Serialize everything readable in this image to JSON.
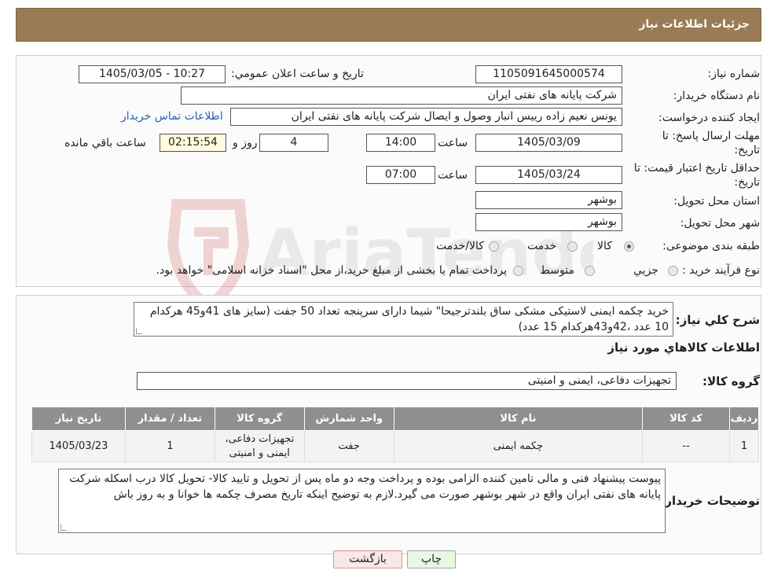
{
  "header": {
    "title": "جزئیات اطلاعات نیاز"
  },
  "labels": {
    "need_number": "شماره نیاز:",
    "announce_datetime": "تاریخ و ساعت اعلان عمومي:",
    "buyer_org": "نام دستگاه خریدار:",
    "requester": "ایجاد کننده درخواست:",
    "reply_deadline_line1": "مهلت ارسال پاسخ: تا",
    "reply_deadline_line2": "تاریخ:",
    "time": "ساعت",
    "days_and": "روز و",
    "remaining": "ساعت باقي مانده",
    "price_validity_line1": "حداقل تاریخ اعتبار قیمت: تا",
    "price_validity_line2": "تاریخ:",
    "province": "استان محل تحویل:",
    "city": "شهر محل تحویل:",
    "category": "طبقه بندی موضوعی:",
    "process_type": "نوع فرآیند خرید :",
    "description": "شرح کلي نیاز:",
    "goods_info": "اطلاعات کالاهاي مورد نیاز",
    "goods_group": "گروه کالا:",
    "buyer_notes": "توضیحات خریدار:"
  },
  "values": {
    "need_number": "1105091645000574",
    "announce_datetime": "1405/03/05 - 10:27",
    "buyer_org": "شرکت پایانه های نفتی ایران",
    "requester": "یونس نعیم زاده رییس انبار وصول و ایصال شرکت پایانه های نفتی ایران",
    "contact_link": "اطلاعات تماس خریدار",
    "reply_date": "1405/03/09",
    "reply_time": "14:00",
    "days_left": "4",
    "time_left": "02:15:54",
    "price_date": "1405/03/24",
    "price_time": "07:00",
    "province": "بوشهر",
    "city": "بوشهر",
    "description": "خرید چکمه ایمنی لاستیکی مشکی ساق بلندترجیحا\" شیما دارای سرپنجه تعداد 50 جفت (سایز های 41و45 هرکدام 10 عدد ،42و43هرکدام 15 عدد)",
    "goods_group": "تجهیزات دفاعی، ایمنی و امنیتی",
    "buyer_notes": "پیوست پیشنهاد فنی و مالی تامین کننده الزامی بوده و پرداخت وجه دو ماه پس از تحویل و تایید کالا- تحویل کالا درب اسکله شرکت پایانه های نفتی ایران واقع در شهر بوشهر صورت می گیرد.لازم به توضیح اینکه تاریخ مصرف چکمه ها خوانا و به روز باش"
  },
  "category_options": [
    {
      "label": "کالا",
      "selected": true
    },
    {
      "label": "خدمت",
      "selected": false
    },
    {
      "label": "کالا/خدمت",
      "selected": false
    }
  ],
  "process_options": [
    {
      "label": "جزیي",
      "selected": false
    },
    {
      "label": "متوسط",
      "selected": false
    },
    {
      "label": "پرداخت تمام یا بخشی از مبلغ خرید،از محل \"اسناد خزانه اسلامی\" خواهد بود.",
      "selected": false
    }
  ],
  "table": {
    "headers": [
      "ردیف",
      "کد کالا",
      "نام کالا",
      "واحد شمارش",
      "گروه کالا",
      "تعداد / مقدار",
      "تاریخ نیاز"
    ],
    "rows": [
      [
        "1",
        "--",
        "چکمه ایمنی",
        "جفت",
        "تجهیزات دفاعی، ایمنی و امنیتی",
        "1",
        "1405/03/23"
      ]
    ]
  },
  "buttons": {
    "print": "چاپ",
    "back": "بازگشت"
  },
  "watermark": {
    "text": "AriaTender.neT"
  }
}
